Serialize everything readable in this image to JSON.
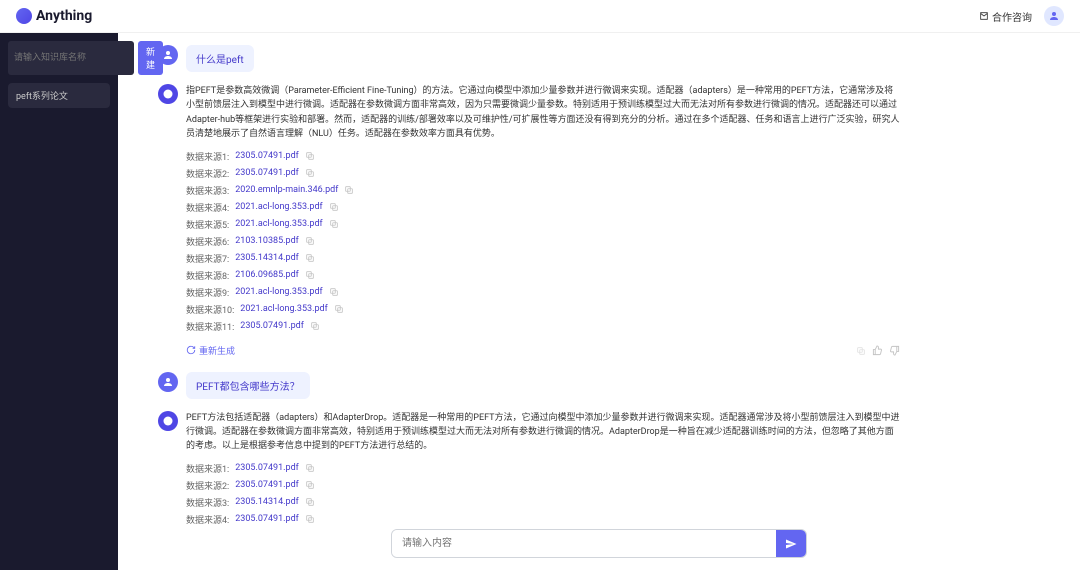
{
  "header": {
    "logo_text": "Anything",
    "partner_label": "合作咨询"
  },
  "sidebar": {
    "input_placeholder": "请输入知识库名称",
    "create_button": "新建",
    "items": [
      {
        "label": "peft系列论文"
      }
    ]
  },
  "chat": {
    "messages": [
      {
        "role": "user",
        "text": "什么是peft"
      },
      {
        "role": "bot",
        "text": "指PEFT是参数高效微调（Parameter-Efficient Fine-Tuning）的方法。它通过向模型中添加少量参数并进行微调来实现。适配器（adapters）是一种常用的PEFT方法，它通常涉及将小型前馈层注入到模型中进行微调。适配器在参数微调方面非常高效，因为只需要微调少量参数。特别适用于预训练模型过大而无法对所有参数进行微调的情况。适配器还可以通过Adapter-hub等框架进行实验和部署。然而，适配器的训练/部署效率以及可维护性/可扩展性等方面还没有得到充分的分析。通过在多个适配器、任务和语言上进行广泛实验，研究人员清楚地展示了自然语言理解（NLU）任务。适配器在参数效率方面具有优势。",
        "sources": [
          {
            "label": "数据来源1:",
            "file": "2305.07491.pdf"
          },
          {
            "label": "数据来源2:",
            "file": "2305.07491.pdf"
          },
          {
            "label": "数据来源3:",
            "file": "2020.emnlp-main.346.pdf"
          },
          {
            "label": "数据来源4:",
            "file": "2021.acl-long.353.pdf"
          },
          {
            "label": "数据来源5:",
            "file": "2021.acl-long.353.pdf"
          },
          {
            "label": "数据来源6:",
            "file": "2103.10385.pdf"
          },
          {
            "label": "数据来源7:",
            "file": "2305.14314.pdf"
          },
          {
            "label": "数据来源8:",
            "file": "2106.09685.pdf"
          },
          {
            "label": "数据来源9:",
            "file": "2021.acl-long.353.pdf"
          },
          {
            "label": "数据来源10:",
            "file": "2021.acl-long.353.pdf"
          },
          {
            "label": "数据来源11:",
            "file": "2305.07491.pdf"
          }
        ],
        "regenerate": "重新生成"
      },
      {
        "role": "user",
        "text": "PEFT都包含哪些方法？"
      },
      {
        "role": "bot",
        "text": "PEFT方法包括适配器（adapters）和AdapterDrop。适配器是一种常用的PEFT方法，它通过向模型中添加少量参数并进行微调来实现。适配器通常涉及将小型前馈层注入到模型中进行微调。适配器在参数微调方面非常高效，特别适用于预训练模型过大而无法对所有参数进行微调的情况。AdapterDrop是一种旨在减少适配器训练时间的方法，但忽略了其他方面的考虑。以上是根据参考信息中提到的PEFT方法进行总结的。",
        "sources": [
          {
            "label": "数据来源1:",
            "file": "2305.07491.pdf"
          },
          {
            "label": "数据来源2:",
            "file": "2305.07491.pdf"
          },
          {
            "label": "数据来源3:",
            "file": "2305.14314.pdf"
          },
          {
            "label": "数据来源4:",
            "file": "2305.07491.pdf"
          }
        ]
      }
    ]
  },
  "input": {
    "placeholder": "请输入内容"
  }
}
